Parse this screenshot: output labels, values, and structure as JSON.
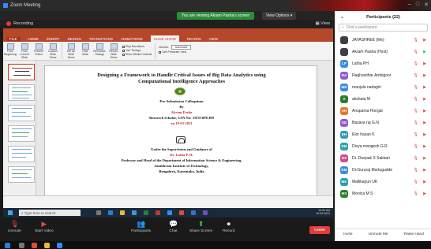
{
  "window": {
    "title": "Zoom Meeting",
    "controls": [
      "–",
      "□",
      "✕"
    ]
  },
  "topbar": {
    "sharing_text": "You are viewing Akram Pasha's screen",
    "view_options_label": "View Options",
    "recording_label": "Recording",
    "view_label": "View"
  },
  "ppt": {
    "tabs": [
      "FILE",
      "HOME",
      "INSERT",
      "DESIGN",
      "TRANSITIONS",
      "ANIMATIONS",
      "SLIDE SHOW",
      "REVIEW",
      "VIEW"
    ],
    "active_tab": "SLIDE SHOW",
    "ribbon_buttons": [
      "From Beginning",
      "From Current Slide",
      "Present Online",
      "Custom Slide Show",
      "Set Up Slide Show",
      "Hide Slide",
      "Rehearse Timings",
      "Record Slide Show"
    ],
    "ribbon_checks": [
      "Play Narrations",
      "Use Timings",
      "Show Media Controls"
    ],
    "monitor_label": "Monitor:",
    "monitor_value": "Automatic",
    "presenter_view_label": "Use Presenter View"
  },
  "slide": {
    "title_line1": "Designing a Framework to Handle Critical Issues of Big Data Analytics using",
    "title_line2": "Computational Intelligence Approaches",
    "colloquium": "Pre-Submission Colloquium",
    "by": "By",
    "presenter": "Akram Pasha",
    "scholar_line": "Research Scholar, USN No: 1SIT16PEJ09",
    "date": "on 19-03-2021",
    "supervision": "Under the Supervision and Guidance of",
    "guide": "Dr. Latha P. H.",
    "guide_role": "Professor and Head of the Department of Information Science & Engineering,",
    "institute": "Sambhram Institute of Technology,",
    "location": "Bengaluru, Karnataka, India"
  },
  "taskbar": {
    "search_placeholder": "Type here to search",
    "time": "10:52 AM",
    "date": "19-03-2021"
  },
  "zoom_controls": {
    "unmute": "Unmute",
    "start_video": "Start Video",
    "participants": "Participants",
    "chat": "Chat",
    "share_screen": "Share Screen",
    "record": "Record",
    "leave": "Leave"
  },
  "participants": {
    "header": "Participants (22)",
    "search_placeholder": "Find a participant",
    "list": [
      {
        "initials": "",
        "name": "JAYASHREE (Me)",
        "color": "#3b3f45",
        "video": "off"
      },
      {
        "initials": "",
        "name": "Akram Pasha (Host)",
        "color": "#3b3f45",
        "video": "on"
      },
      {
        "initials": "LP",
        "name": "Latha PH",
        "color": "#3c8be0",
        "video": "off"
      },
      {
        "initials": "RA",
        "name": "Raghavithar Ambigoor",
        "color": "#8c5fd0",
        "video": "off"
      },
      {
        "initials": "MN",
        "name": "manjula nadagiri",
        "color": "#3c8be0",
        "video": "off"
      },
      {
        "initials": "A",
        "name": "akshata M",
        "color": "#2e7d32",
        "video": "off"
      },
      {
        "initials": "AH",
        "name": "Anupama Hongal",
        "color": "#e0782e",
        "video": "off"
      },
      {
        "initials": "SG",
        "name": "Basava raj G.N.",
        "color": "#8c5fd0",
        "video": "off"
      },
      {
        "initials": "EH",
        "name": "Elor hasan K",
        "color": "#2e9fb0",
        "video": "off"
      },
      {
        "initials": "DM",
        "name": "Divya mangesh G.R",
        "color": "#2e9fb0",
        "video": "off"
      },
      {
        "initials": "DS",
        "name": "Dr. Deepak S Sakkari",
        "color": "#d04a8a",
        "video": "off"
      },
      {
        "initials": "DM",
        "name": "Dr.Gururaj Murtugudde",
        "color": "#3c8be0",
        "video": "off"
      },
      {
        "initials": "MK",
        "name": "Mallikarjun UK",
        "color": "#2e9fb0",
        "video": "off"
      },
      {
        "initials": "MS",
        "name": "Monica M S",
        "color": "#2e7d32",
        "video": "off"
      }
    ],
    "footer": {
      "invite": "Invite",
      "unmute_me": "Unmute Me",
      "raise_hand": "Raise Hand"
    }
  }
}
